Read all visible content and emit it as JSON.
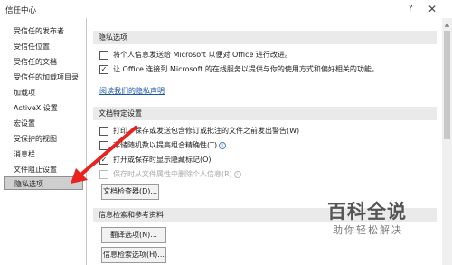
{
  "window": {
    "title": "信任中心",
    "help_label": "?",
    "close_label": "✕"
  },
  "sidebar": {
    "items": [
      {
        "label": "受信任的发布者"
      },
      {
        "label": "受信任位置"
      },
      {
        "label": "受信任的文档"
      },
      {
        "label": "受信任的加载项目录"
      },
      {
        "label": "加载项"
      },
      {
        "label": "ActiveX 设置"
      },
      {
        "label": "宏设置"
      },
      {
        "label": "受保护的视图"
      },
      {
        "label": "消息栏"
      },
      {
        "label": "文件阻止设置"
      },
      {
        "label": "隐私选项",
        "active": true
      }
    ]
  },
  "privacy_section": {
    "header": "隐私选项",
    "options": [
      {
        "label": "将个人信息发送给 Microsoft 以便对 Office 进行改进。",
        "checked": false
      },
      {
        "label": "让 Office 连接到 Microsoft 的在线服务以提供与你的使用方式和偏好相关的功能。",
        "checked": true
      }
    ],
    "link": "阅读我们的隐私声明"
  },
  "document_section": {
    "header": "文档特定设置",
    "options": [
      {
        "label": "打印、保存或发送包含修订或批注的文件之前发出警告(W)",
        "checked": false,
        "enabled": true
      },
      {
        "label": "存储随机数以提高组合精确性(T)",
        "checked": false,
        "enabled": true,
        "info": true
      },
      {
        "label": "打开或保存时显示隐藏标记(O)",
        "checked": true,
        "enabled": true
      },
      {
        "label": "保存时从文件属性中删除个人信息(R)",
        "checked": false,
        "enabled": false,
        "info": true
      }
    ],
    "button": "文档检查器(D)..."
  },
  "research_section": {
    "header": "信息检索和参考资料",
    "buttons": [
      "翻译选项(N)...",
      "信息检索选项(H)..."
    ]
  },
  "watermark": {
    "main": "百科全说",
    "sub": "助你轻松解决"
  },
  "icons": {
    "check": "✓",
    "info": "i",
    "scroll_up": "▲"
  },
  "colors": {
    "link": "#1a56a8",
    "arrow": "#e8231f",
    "selected_item_bg": "#cfcfcf",
    "section_header_bg": "#eaeaea"
  }
}
